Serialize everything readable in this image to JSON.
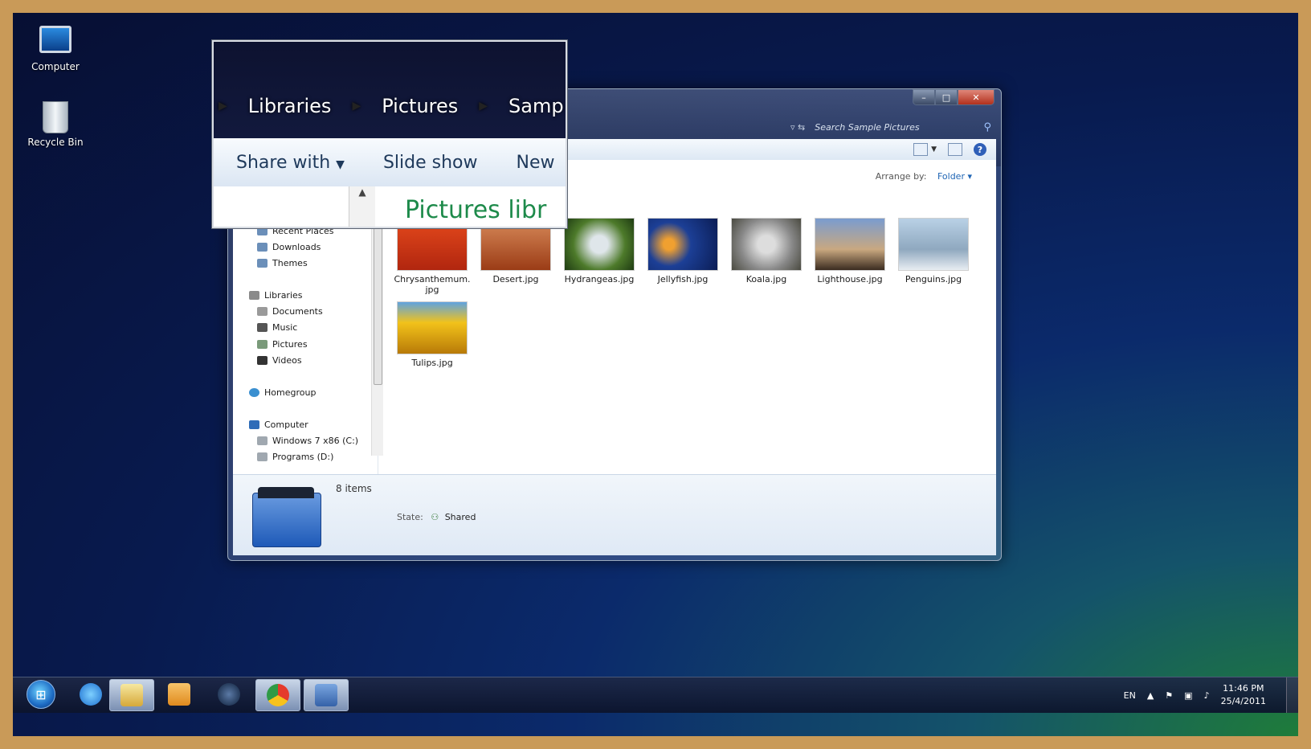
{
  "desktop": {
    "icons": [
      {
        "label": "Computer"
      },
      {
        "label": "Recycle Bin"
      }
    ]
  },
  "explorer": {
    "search_placeholder": "Search Sample Pictures",
    "window_buttons": {
      "minimize": "–",
      "maximize": "□",
      "close": "✕"
    },
    "arrange_label": "Arrange by:",
    "arrange_value": "Folder",
    "nav_items": [
      {
        "label": "Recent Places"
      },
      {
        "label": "Downloads"
      },
      {
        "label": "Themes"
      },
      {
        "label": "Libraries"
      },
      {
        "label": "Documents"
      },
      {
        "label": "Music"
      },
      {
        "label": "Pictures"
      },
      {
        "label": "Videos"
      },
      {
        "label": "Homegroup"
      },
      {
        "label": "Computer"
      },
      {
        "label": "Windows 7 x86 (C:)"
      },
      {
        "label": "Programs (D:)"
      }
    ],
    "files": [
      {
        "name": "Chrysanthemum.\njpg",
        "color": "#d13b1a"
      },
      {
        "name": "Desert.jpg",
        "color": "#b4531f"
      },
      {
        "name": "Hydrangeas.jpg",
        "color": "#6f8f3a"
      },
      {
        "name": "Jellyfish.jpg",
        "color": "#1b3d8f"
      },
      {
        "name": "Koala.jpg",
        "color": "#9a9a98"
      },
      {
        "name": "Lighthouse.jpg",
        "color": "#6a87b4"
      },
      {
        "name": "Penguins.jpg",
        "color": "#9fb8cf"
      },
      {
        "name": "Tulips.jpg",
        "color": "#e7b21c"
      }
    ],
    "details": {
      "count": "8 items",
      "state_label": "State:",
      "state_value": "Shared"
    }
  },
  "magnifier": {
    "breadcrumb": [
      "Libraries",
      "Pictures",
      "Samp"
    ],
    "commands": [
      "Share with",
      "Slide show",
      "New"
    ],
    "heading": "Pictures libr"
  },
  "taskbar": {
    "language": "EN",
    "time": "11:46 PM",
    "date": "25/4/2011"
  }
}
